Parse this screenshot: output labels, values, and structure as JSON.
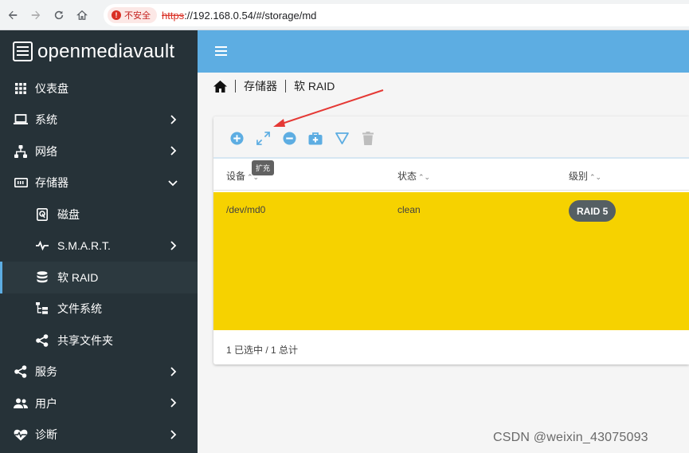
{
  "browser": {
    "security_label": "不安全",
    "url_scheme": "https",
    "url_rest": "://192.168.0.54/#/storage/md"
  },
  "app": {
    "logo_text": "openmediavault"
  },
  "sidebar": {
    "items": [
      {
        "label": "仪表盘",
        "icon": "dashboard-grid-icon",
        "has_chevron": false
      },
      {
        "label": "系统",
        "icon": "laptop-icon",
        "has_chevron": true
      },
      {
        "label": "网络",
        "icon": "network-icon",
        "has_chevron": true
      },
      {
        "label": "存储器",
        "icon": "storage-icon",
        "has_chevron": true,
        "expanded": true
      },
      {
        "label": "磁盘",
        "icon": "disk-icon",
        "sub": true
      },
      {
        "label": "S.M.A.R.T.",
        "icon": "pulse-icon",
        "sub": true,
        "has_chevron": true
      },
      {
        "label": "软 RAID",
        "icon": "database-icon",
        "sub": true,
        "active": true
      },
      {
        "label": "文件系统",
        "icon": "filesystem-tree-icon",
        "sub": true
      },
      {
        "label": "共享文件夹",
        "icon": "share-icon",
        "sub": true
      },
      {
        "label": "服务",
        "icon": "share-icon",
        "has_chevron": true
      },
      {
        "label": "用户",
        "icon": "users-icon",
        "has_chevron": true
      },
      {
        "label": "诊断",
        "icon": "heart-pulse-icon",
        "has_chevron": true
      }
    ]
  },
  "breadcrumb": {
    "item1": "存储器",
    "item2": "软 RAID"
  },
  "toolbar": {
    "tooltip": "扩充"
  },
  "table": {
    "headers": [
      "设备",
      "状态",
      "级别"
    ],
    "sort_glyph": "⌃⌄",
    "rows": [
      {
        "device": "/dev/md0",
        "state": "clean",
        "level": "RAID 5"
      }
    ],
    "footer": "1 已选中 / 1 总计"
  },
  "watermark": "CSDN @weixin_43075093",
  "colors": {
    "accent": "#5dade2",
    "sidebar": "#263238",
    "selected_row": "#f6d200",
    "annotation_arrow": "#e53935"
  }
}
